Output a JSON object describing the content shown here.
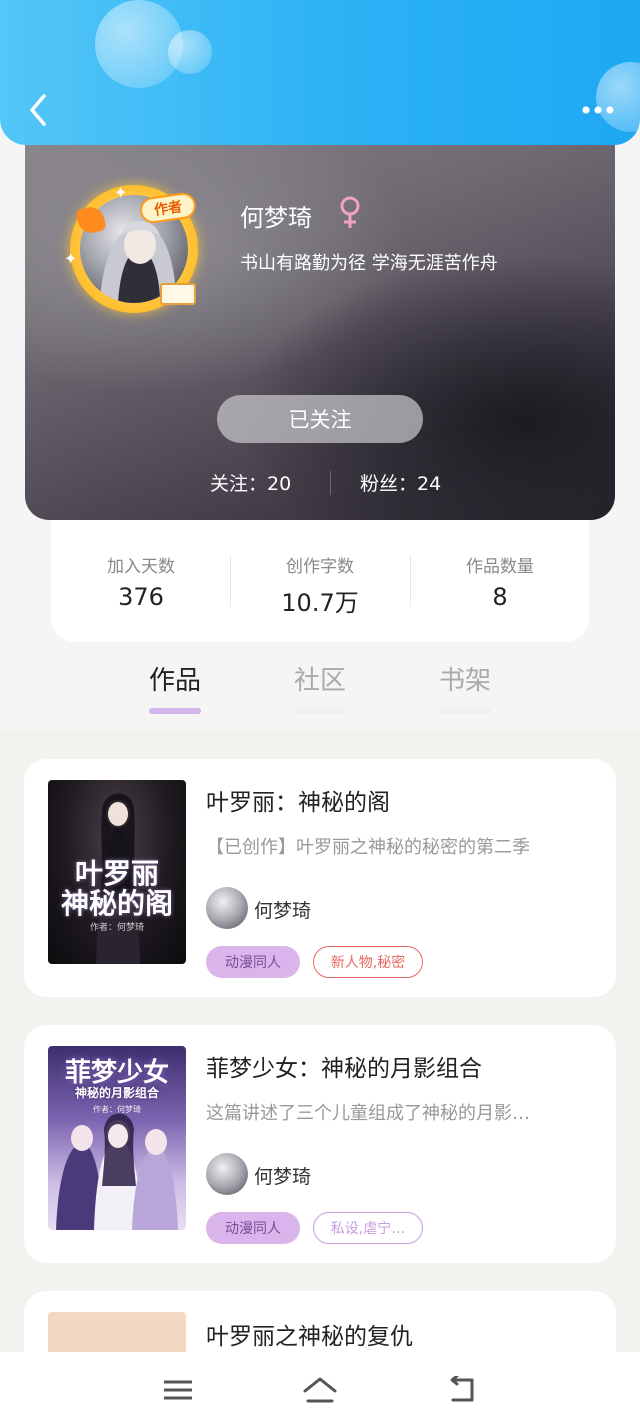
{
  "profile": {
    "name": "何梦琦",
    "motto": "书山有路勤为径 学海无涯苦作舟",
    "badge": "作者",
    "follow_button": "已关注",
    "following_label": "关注：20",
    "fans_label": "粉丝：24"
  },
  "stats": [
    {
      "label": "加入天数",
      "value": "376"
    },
    {
      "label": "创作字数",
      "value": "10.7万"
    },
    {
      "label": "作品数量",
      "value": "8"
    }
  ],
  "tabs": [
    {
      "label": "作品",
      "active": true
    },
    {
      "label": "社区",
      "active": false
    },
    {
      "label": "书架",
      "active": false
    }
  ],
  "books": [
    {
      "title": "叶罗丽：神秘的阁",
      "description": "【已创作】叶罗丽之神秘的秘密的第二季",
      "author": "何梦琦",
      "genre_tag": "动漫同人",
      "keyword_tag": "新人物,秘密",
      "cover_title_line1": "叶罗丽",
      "cover_title_line2": "神秘的阁",
      "cover_author": "作者：何梦琦"
    },
    {
      "title": "菲梦少女：神秘的月影组合",
      "description": "这篇讲述了三个儿童组成了神秘的月影…",
      "author": "何梦琦",
      "genre_tag": "动漫同人",
      "keyword_tag": "私设,虐宁…",
      "cover_title_line1": "菲梦少女",
      "cover_title_line2": "神秘的月影组合",
      "cover_author": "作者：何梦琦"
    },
    {
      "title": "叶罗丽之神秘的复仇"
    }
  ],
  "colors": {
    "top_bar": "#2bb2f5",
    "tab_indicator": "#d3b6ec",
    "tag_genre_bg": "#d9b5ec",
    "tag_red": "#e7685f",
    "tag_purple": "#c79be0"
  },
  "icons": {
    "back": "chevron-left-icon",
    "more": "more-dots-icon",
    "gender": "female-icon",
    "nav_menu": "menu-icon",
    "nav_home": "home-icon",
    "nav_back": "return-icon"
  }
}
